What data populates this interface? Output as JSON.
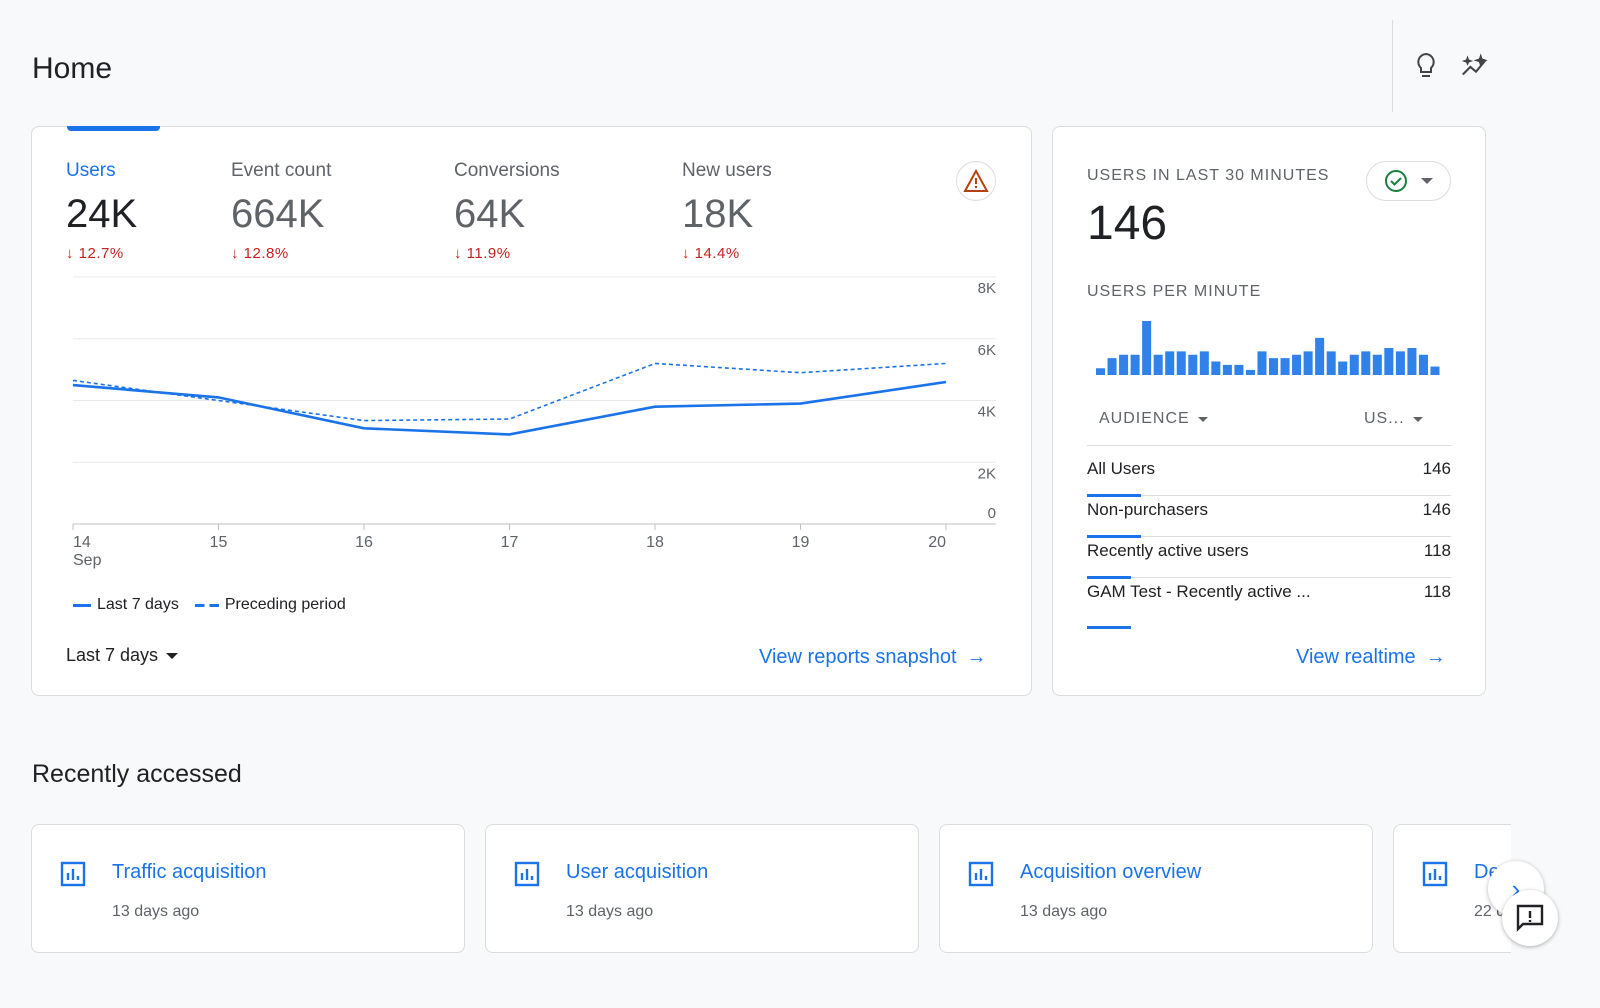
{
  "page_title": "Home",
  "header_icons": [
    "lightbulb-icon",
    "insights-sparkle-icon"
  ],
  "metrics": [
    {
      "label": "Users",
      "value": "24K",
      "change": "12.7%"
    },
    {
      "label": "Event count",
      "value": "664K",
      "change": "12.8%"
    },
    {
      "label": "Conversions",
      "value": "64K",
      "change": "11.9%"
    },
    {
      "label": "New users",
      "value": "18K",
      "change": "14.4%"
    }
  ],
  "chart_data": [
    {
      "type": "line",
      "categories": [
        "14",
        "15",
        "16",
        "17",
        "18",
        "19",
        "20"
      ],
      "x_month_label": "Sep",
      "y_ticks": [
        "0",
        "2K",
        "4K",
        "6K",
        "8K"
      ],
      "ylim": [
        0,
        8000
      ],
      "grid": true,
      "legend_placement": "bottom-left",
      "series": [
        {
          "name": "Last 7 days",
          "style": "solid",
          "color": "#1a73e8",
          "values": [
            4500,
            4100,
            3100,
            2900,
            3800,
            3900,
            4600
          ]
        },
        {
          "name": "Preceding period",
          "style": "dashed",
          "color": "#1a73e8",
          "values": [
            4650,
            4000,
            3350,
            3400,
            5200,
            4900,
            5200
          ]
        }
      ]
    },
    {
      "type": "bar",
      "title": "USERS PER MINUTE",
      "color": "#1a73e8",
      "values": [
        2,
        5,
        6,
        6,
        16,
        6,
        7,
        7,
        6,
        7,
        4,
        3,
        3,
        1.5,
        7,
        5,
        5,
        6,
        7,
        11,
        7,
        4,
        6,
        7,
        6,
        8,
        7,
        8,
        6,
        2.5
      ]
    }
  ],
  "date_range": "Last 7 days",
  "view_snapshot": "View reports snapshot",
  "realtime": {
    "title": "USERS IN LAST 30 MINUTES",
    "value": "146",
    "per_minute": "USERS PER MINUTE",
    "col_audience": "AUDIENCE",
    "col_users": "US...",
    "rows": [
      {
        "name": "All Users",
        "value": "146"
      },
      {
        "name": "Non-purchasers",
        "value": "146"
      },
      {
        "name": "Recently active users",
        "value": "118"
      },
      {
        "name": "GAM Test - Recently active ...",
        "value": "118"
      }
    ],
    "view_link": "View realtime"
  },
  "recent_title": "Recently accessed",
  "recent": [
    {
      "name": "Traffic acquisition",
      "time": "13 days ago"
    },
    {
      "name": "User acquisition",
      "time": "13 days ago"
    },
    {
      "name": "Acquisition overview",
      "time": "13 days ago"
    },
    {
      "name": "De",
      "time": "22 d"
    }
  ],
  "status_color": "#188038",
  "accent": "#1a73e8",
  "negative_color": "#c5221f",
  "warning_color": "#b3420d"
}
